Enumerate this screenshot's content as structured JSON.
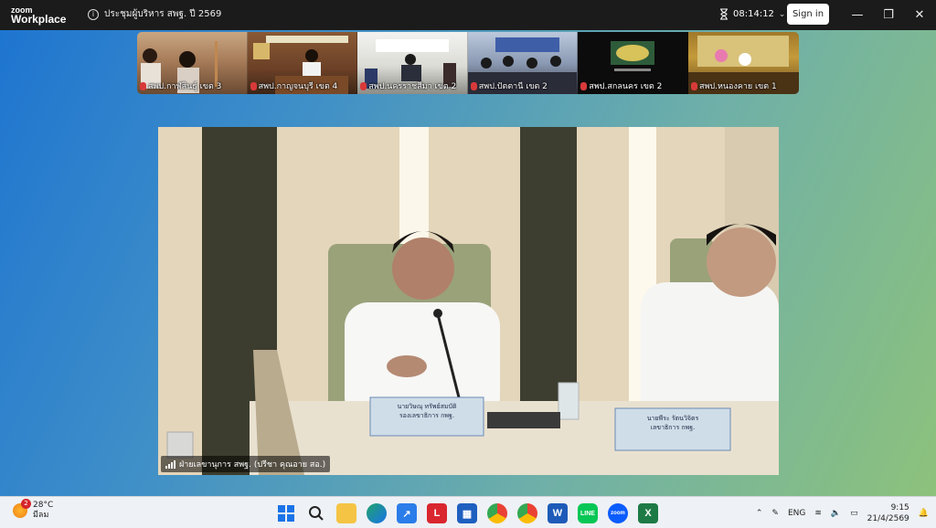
{
  "app": {
    "logo_line1": "zoom",
    "logo_line2": "Workplace"
  },
  "meeting": {
    "title": "ประชุมผู้บริหาร สพฐ. ปี 2569",
    "timer": "08:14:12"
  },
  "auth": {
    "signin_label": "Sign in"
  },
  "window_controls": {
    "minimize": "—",
    "maximize": "❐",
    "close": "✕"
  },
  "thumbnails": [
    {
      "label": "สพป.กาฬสินธุ์ เขต 3",
      "muted": true
    },
    {
      "label": "สพป.กาญจนบุรี เขต 4",
      "muted": true
    },
    {
      "label": "สพป.นครราชสีมา เขต 2",
      "muted": true
    },
    {
      "label": "สพป.ปัตตานี เขต 2",
      "muted": true
    },
    {
      "label": "สพป.สกลนคร เขต 2",
      "muted": true
    },
    {
      "label": "สพป.หนองคาย เขต 1",
      "muted": true
    }
  ],
  "main_video": {
    "speaker_label": "ฝ่ายเลขานุการ สพฐ. (ปรีชา  คุณอาย สอ.)",
    "nameplate_left_name": "นายวิษณุ ทรัพย์สมบัติ",
    "nameplate_left_title": "รองเลขาธิการ กพฐ.",
    "nameplate_right_name": "นายพีระ  รัตนวิจิตร",
    "nameplate_right_title": "เลขาธิการ กพฐ."
  },
  "taskbar": {
    "weather_temp": "28°C",
    "weather_desc": "มีลม",
    "notification_count": "2",
    "language": "ENG",
    "time": "9:15",
    "date": "21/4/2569",
    "icons": [
      "windows-start",
      "search",
      "file-explorer",
      "edge",
      "app-blue",
      "app-red-L",
      "store",
      "chrome",
      "chrome-alt",
      "word",
      "line",
      "zoom",
      "excel"
    ]
  },
  "colors": {
    "titlebar": "#1b1b1b",
    "accent_blue": "#0b5cff",
    "muted_red": "#d83a3a"
  }
}
